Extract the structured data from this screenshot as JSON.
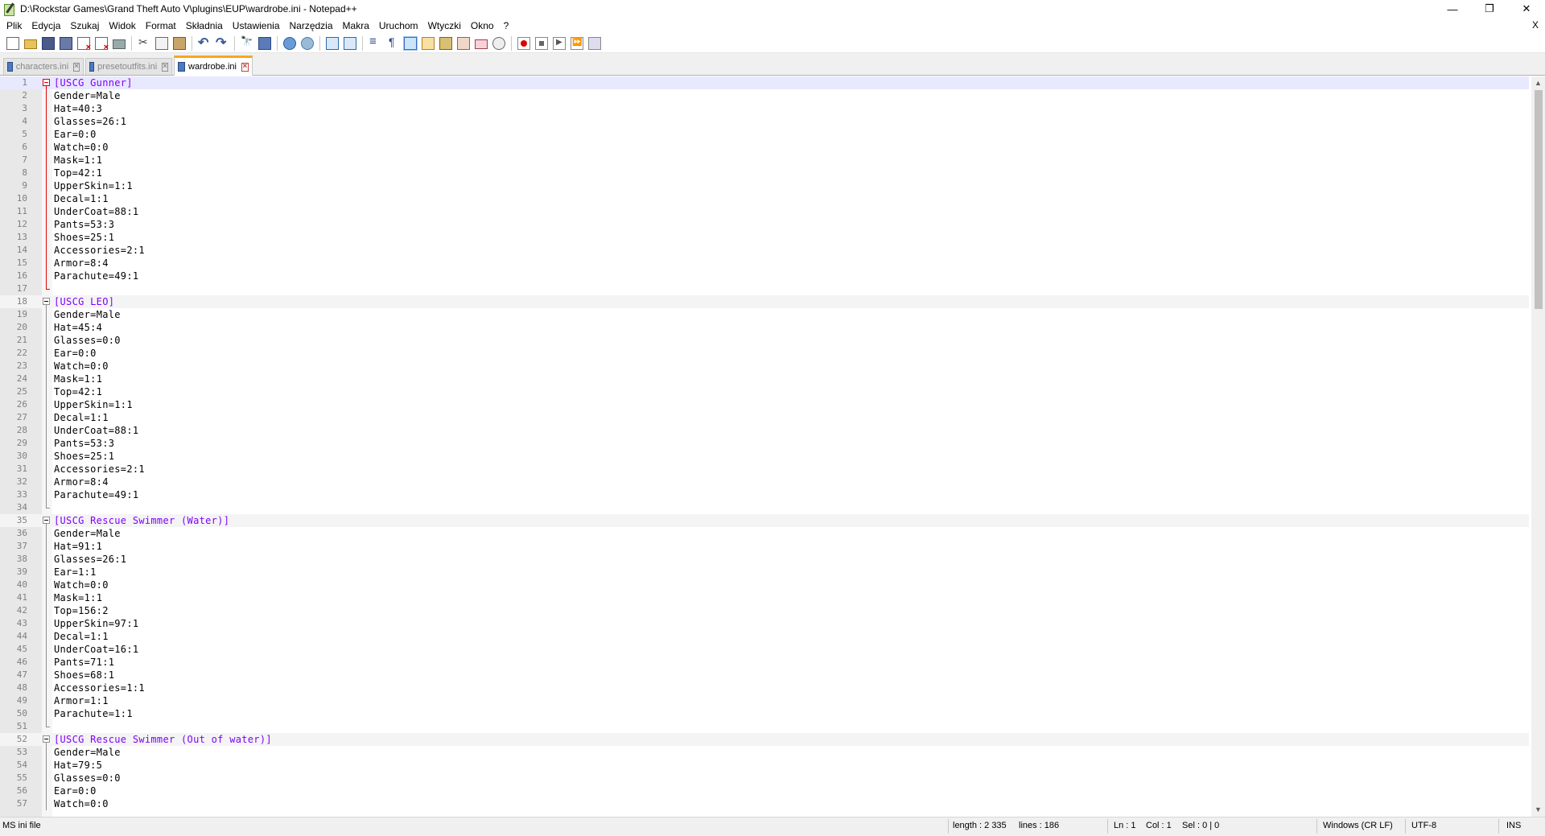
{
  "window": {
    "title": "D:\\Rockstar Games\\Grand Theft Auto V\\plugins\\EUP\\wardrobe.ini - Notepad++",
    "minimize": "—",
    "maximize": "❐",
    "close": "✕"
  },
  "menu": {
    "items": [
      "Plik",
      "Edycja",
      "Szukaj",
      "Widok",
      "Format",
      "Składnia",
      "Ustawienia",
      "Narzędzia",
      "Makra",
      "Uruchom",
      "Wtyczki",
      "Okno",
      "?"
    ],
    "close_doc": "X"
  },
  "toolbar": {
    "icons": [
      "new-file-icon",
      "open-file-icon",
      "save-icon",
      "save-all-icon",
      "close-icon",
      "close-all-icon",
      "print-icon",
      "cut-icon",
      "copy-icon",
      "paste-icon",
      "undo-icon",
      "redo-icon",
      "find-icon",
      "replace-icon",
      "zoom-in-icon",
      "zoom-out-icon",
      "sync-vertical-icon",
      "sync-horizontal-icon",
      "word-wrap-icon",
      "show-all-chars-icon",
      "indent-guide-icon",
      "user-language-icon",
      "document-map-icon",
      "function-list-icon",
      "folder-workspace-icon",
      "monitoring-icon",
      "record-macro-icon",
      "stop-macro-icon",
      "play-macro-icon",
      "run-macro-multiple-icon",
      "save-macro-icon"
    ]
  },
  "tabs": [
    {
      "label": "characters.ini",
      "active": false
    },
    {
      "label": "presetoutfits.ini",
      "active": false
    },
    {
      "label": "wardrobe.ini",
      "active": true
    }
  ],
  "editor": {
    "lines": [
      {
        "n": "1",
        "section": "[USCG Gunner]"
      },
      {
        "n": "2",
        "key": "Gender",
        "val": "Male"
      },
      {
        "n": "3",
        "key": "Hat",
        "val": "40:3"
      },
      {
        "n": "4",
        "key": "Glasses",
        "val": "26:1"
      },
      {
        "n": "5",
        "key": "Ear",
        "val": "0:0"
      },
      {
        "n": "6",
        "key": "Watch",
        "val": "0:0"
      },
      {
        "n": "7",
        "key": "Mask",
        "val": "1:1"
      },
      {
        "n": "8",
        "key": "Top",
        "val": "42:1"
      },
      {
        "n": "9",
        "key": "UpperSkin",
        "val": "1:1"
      },
      {
        "n": "10",
        "key": "Decal",
        "val": "1:1"
      },
      {
        "n": "11",
        "key": "UnderCoat",
        "val": "88:1"
      },
      {
        "n": "12",
        "key": "Pants",
        "val": "53:3"
      },
      {
        "n": "13",
        "key": "Shoes",
        "val": "25:1"
      },
      {
        "n": "14",
        "key": "Accessories",
        "val": "2:1"
      },
      {
        "n": "15",
        "key": "Armor",
        "val": "8:4"
      },
      {
        "n": "16",
        "key": "Parachute",
        "val": "49:1"
      },
      {
        "n": "17"
      },
      {
        "n": "18",
        "section": "[USCG LEO]"
      },
      {
        "n": "19",
        "key": "Gender",
        "val": "Male"
      },
      {
        "n": "20",
        "key": "Hat",
        "val": "45:4"
      },
      {
        "n": "21",
        "key": "Glasses",
        "val": "0:0"
      },
      {
        "n": "22",
        "key": "Ear",
        "val": "0:0"
      },
      {
        "n": "23",
        "key": "Watch",
        "val": "0:0"
      },
      {
        "n": "24",
        "key": "Mask",
        "val": "1:1"
      },
      {
        "n": "25",
        "key": "Top",
        "val": "42:1"
      },
      {
        "n": "26",
        "key": "UpperSkin",
        "val": "1:1"
      },
      {
        "n": "27",
        "key": "Decal",
        "val": "1:1"
      },
      {
        "n": "28",
        "key": "UnderCoat",
        "val": "88:1"
      },
      {
        "n": "29",
        "key": "Pants",
        "val": "53:3"
      },
      {
        "n": "30",
        "key": "Shoes",
        "val": "25:1"
      },
      {
        "n": "31",
        "key": "Accessories",
        "val": "2:1"
      },
      {
        "n": "32",
        "key": "Armor",
        "val": "8:4"
      },
      {
        "n": "33",
        "key": "Parachute",
        "val": "49:1"
      },
      {
        "n": "34"
      },
      {
        "n": "35",
        "section": "[USCG Rescue Swimmer (Water)]"
      },
      {
        "n": "36",
        "key": "Gender",
        "val": "Male"
      },
      {
        "n": "37",
        "key": "Hat",
        "val": "91:1"
      },
      {
        "n": "38",
        "key": "Glasses",
        "val": "26:1"
      },
      {
        "n": "39",
        "key": "Ear",
        "val": "1:1"
      },
      {
        "n": "40",
        "key": "Watch",
        "val": "0:0"
      },
      {
        "n": "41",
        "key": "Mask",
        "val": "1:1"
      },
      {
        "n": "42",
        "key": "Top",
        "val": "156:2"
      },
      {
        "n": "43",
        "key": "UpperSkin",
        "val": "97:1"
      },
      {
        "n": "44",
        "key": "Decal",
        "val": "1:1"
      },
      {
        "n": "45",
        "key": "UnderCoat",
        "val": "16:1"
      },
      {
        "n": "46",
        "key": "Pants",
        "val": "71:1"
      },
      {
        "n": "47",
        "key": "Shoes",
        "val": "68:1"
      },
      {
        "n": "48",
        "key": "Accessories",
        "val": "1:1"
      },
      {
        "n": "49",
        "key": "Armor",
        "val": "1:1"
      },
      {
        "n": "50",
        "key": "Parachute",
        "val": "1:1"
      },
      {
        "n": "51"
      },
      {
        "n": "52",
        "section": "[USCG Rescue Swimmer (Out of water)]"
      },
      {
        "n": "53",
        "key": "Gender",
        "val": "Male"
      },
      {
        "n": "54",
        "key": "Hat",
        "val": "79:5"
      },
      {
        "n": "55",
        "key": "Glasses",
        "val": "0:0"
      },
      {
        "n": "56",
        "key": "Ear",
        "val": "0:0"
      },
      {
        "n": "57",
        "key": "Watch",
        "val": "0:0"
      }
    ]
  },
  "scrollbar": {
    "up": "▲",
    "down": "▼"
  },
  "status": {
    "filetype": "MS ini file",
    "length": "length : 2 335",
    "lines": "lines : 186",
    "ln": "Ln : 1",
    "col": "Col : 1",
    "sel": "Sel : 0 | 0",
    "eol": "Windows (CR LF)",
    "encoding": "UTF-8",
    "mode": "INS"
  },
  "colors": {
    "section": "#8000ff",
    "current_line": "#e8e8ff",
    "active_tab_accent": "#faa61a",
    "fold_active": "#e00000"
  }
}
